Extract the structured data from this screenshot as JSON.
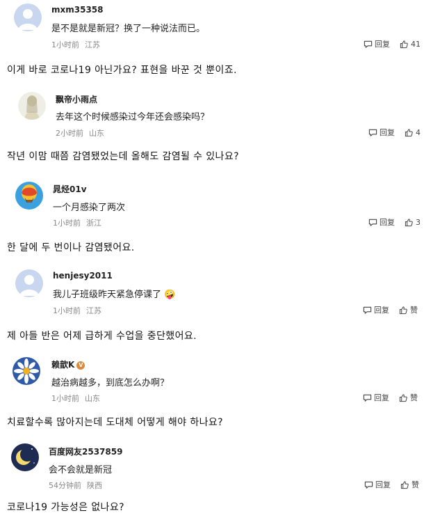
{
  "comments": [
    {
      "username": "mxm35358",
      "text": "是不是就是新冠？换了一种说法而已。",
      "time": "1小时前",
      "location": "江苏",
      "reply_label": "回复",
      "like_label": "41",
      "avatar": "default-avatar",
      "translation": "이게 바로 코로나19 아닌가요? 표현을 바꾼 것 뿐이죠."
    },
    {
      "username": "飘帝小雨点",
      "text": "去年这个时候感染过今年还会感染吗？",
      "time": "2小时前",
      "location": "山东",
      "reply_label": "回复",
      "like_label": "4",
      "avatar": "figure-avatar",
      "translation": "작년 이맘 때쯤 감염됐었는데 올해도 감염될 수 있나요?"
    },
    {
      "username": "晁烃01v",
      "text": "一个月感染了两次",
      "time": "1小时前",
      "location": "浙江",
      "reply_label": "回复",
      "like_label": "3",
      "avatar": "balloon-avatar",
      "translation": "한 달에 두 번이나 감염됐어요."
    },
    {
      "username": "henjesy2011",
      "text": "我儿子班级昨天紧急停课了 🤪",
      "time": "1小时前",
      "location": "江苏",
      "reply_label": "回复",
      "like_label": "赞",
      "avatar": "default-avatar",
      "translation": "제 아들 반은 어제 급하게 수업을 중단했어요."
    },
    {
      "username": "赖歆K",
      "badge": "V",
      "text": "越治病越多，到底怎么办啊？",
      "time": "1小时前",
      "location": "山东",
      "reply_label": "回复",
      "like_label": "赞",
      "avatar": "daisy-avatar",
      "translation": "치료할수록 많아지는데 도대체 어떻게 해야 하나요?"
    },
    {
      "username": "百度网友2537859",
      "text": "会不会就是新冠",
      "time": "54分钟前",
      "location": "陕西",
      "reply_label": "回复",
      "like_label": "赞",
      "avatar": "moon-avatar",
      "translation": "코로나19 가능성은 없나요?"
    }
  ]
}
